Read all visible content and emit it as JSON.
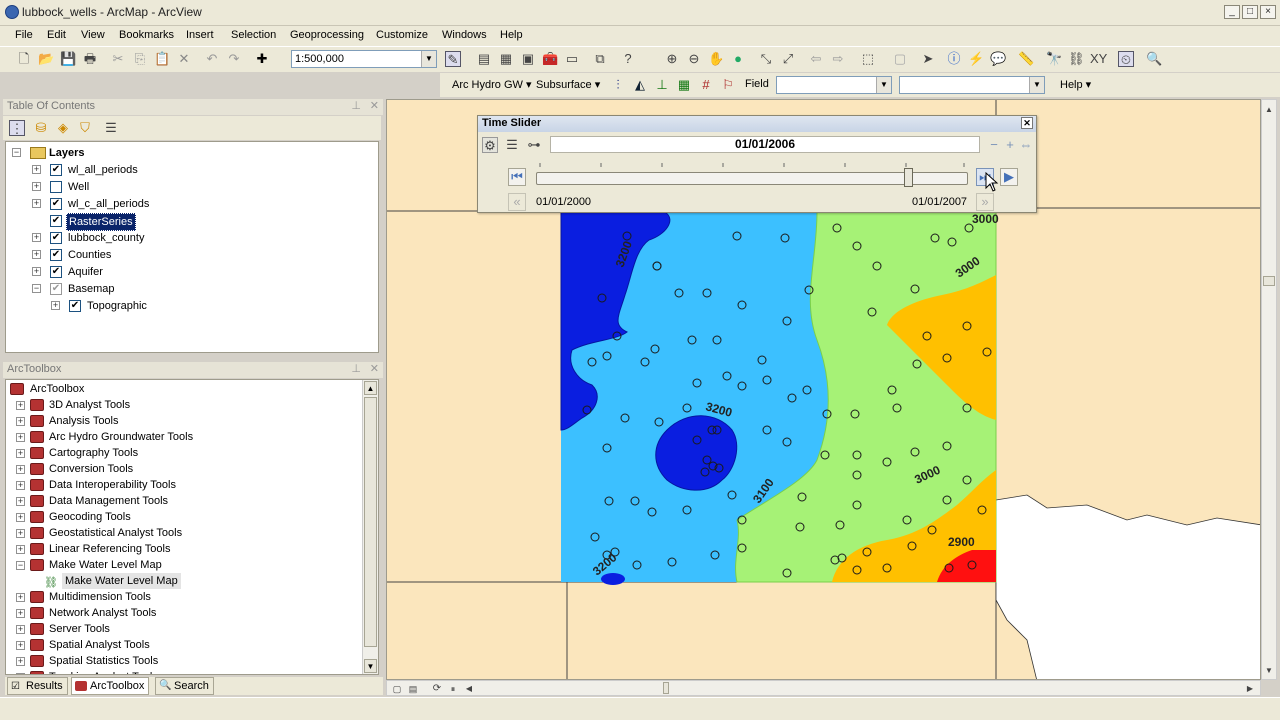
{
  "window": {
    "title": "lubbock_wells - ArcMap - ArcView",
    "min": "_",
    "max": "□",
    "close": "×"
  },
  "menu": [
    "File",
    "Edit",
    "View",
    "Bookmarks",
    "Insert",
    "Selection",
    "Geoprocessing",
    "Customize",
    "Windows",
    "Help"
  ],
  "toolbar": {
    "scale_value": "1:500,000",
    "arc_hydro_label": "Arc Hydro GW ▾",
    "subsurface_label": "Subsurface ▾",
    "field_label": "Field",
    "help_label": "Help ▾"
  },
  "toc": {
    "header": "Table Of Contents",
    "root": "Layers",
    "layers": [
      {
        "label": "wl_all_periods",
        "checked": true,
        "expandable": true
      },
      {
        "label": "Well",
        "checked": false,
        "expandable": true
      },
      {
        "label": "wl_c_all_periods",
        "checked": true,
        "expandable": true
      },
      {
        "label": "RasterSeries",
        "checked": true,
        "expandable": false,
        "selected": true
      },
      {
        "label": "lubbock_county",
        "checked": true,
        "expandable": true
      },
      {
        "label": "Counties",
        "checked": true,
        "expandable": true
      },
      {
        "label": "Aquifer",
        "checked": true,
        "expandable": true
      },
      {
        "label": "Basemap",
        "checked": true,
        "expandable": true,
        "expanded": true
      },
      {
        "label": "Topographic",
        "checked": true,
        "expandable": true,
        "indent": true
      }
    ]
  },
  "toolbox": {
    "header": "ArcToolbox",
    "root": "ArcToolbox",
    "items": [
      {
        "label": "3D Analyst Tools"
      },
      {
        "label": "Analysis Tools"
      },
      {
        "label": "Arc Hydro Groundwater Tools"
      },
      {
        "label": "Cartography Tools"
      },
      {
        "label": "Conversion Tools"
      },
      {
        "label": "Data Interoperability Tools"
      },
      {
        "label": "Data Management Tools"
      },
      {
        "label": "Geocoding Tools"
      },
      {
        "label": "Geostatistical Analyst Tools"
      },
      {
        "label": "Linear Referencing Tools"
      },
      {
        "label": "Make Water Level Map",
        "expanded": true
      },
      {
        "label": "Make Water Level Map",
        "child": true
      },
      {
        "label": "Multidimension Tools"
      },
      {
        "label": "Network Analyst Tools"
      },
      {
        "label": "Server Tools"
      },
      {
        "label": "Spatial Analyst Tools"
      },
      {
        "label": "Spatial Statistics Tools"
      },
      {
        "label": "Tracking Analyst Tools"
      }
    ]
  },
  "bottom_tabs": [
    "Results",
    "ArcToolbox",
    "Search"
  ],
  "time_slider": {
    "title": "Time Slider",
    "current_date": "01/01/2006",
    "start_date": "01/01/2000",
    "end_date": "01/01/2007",
    "position": 0.86
  },
  "map": {
    "contour_labels": [
      "3200",
      "3000",
      "3000",
      "3200",
      "3100",
      "3000",
      "2900",
      "3200"
    ]
  },
  "colors": {
    "deep_blue": "#0a1ee0",
    "light_blue": "#3cc0ff",
    "green": "#a6f276",
    "orange": "#ffc000",
    "red": "#ff1010",
    "basemap": "#fbe6bd"
  }
}
